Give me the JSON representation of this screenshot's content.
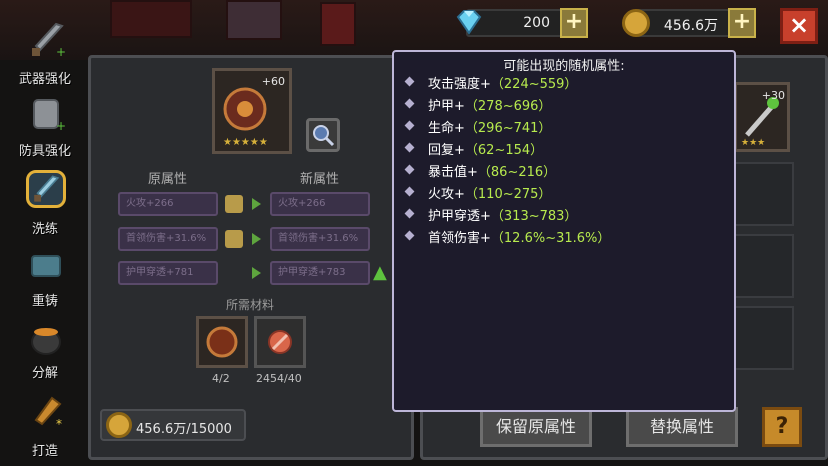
{
  "currency": {
    "gems": "200",
    "coins": "456.6万"
  },
  "sidebar": {
    "items": [
      {
        "label": "武器强化"
      },
      {
        "label": "防具强化"
      },
      {
        "label": "洗练"
      },
      {
        "label": "重铸"
      },
      {
        "label": "分解"
      },
      {
        "label": "打造"
      }
    ]
  },
  "item": {
    "level_badge": "+60",
    "compare_level_badge": "+30"
  },
  "attributes": {
    "old_header": "原属性",
    "new_header": "新属性",
    "rows": [
      {
        "old": "火攻+266",
        "new": "火攻+266"
      },
      {
        "old": "首领伤害+31.6%",
        "new": "首领伤害+31.6%"
      },
      {
        "old": "护甲穿透+781",
        "new": "护甲穿透+783"
      }
    ]
  },
  "materials": {
    "header": "所需材料",
    "items": [
      {
        "count": "4/2"
      },
      {
        "count": "2454/40"
      }
    ]
  },
  "cost": "456.6万/15000",
  "buttons": {
    "keep": "保留原属性",
    "replace": "替换属性",
    "help": "?",
    "close": "×"
  },
  "tooltip": {
    "title": "可能出现的随机属性:",
    "rows": [
      {
        "name": "攻击强度+",
        "range": "（224~559）"
      },
      {
        "name": "护甲+",
        "range": "（278~696）"
      },
      {
        "name": "生命+",
        "range": "（296~741）"
      },
      {
        "name": "回复+",
        "range": "（62~154）"
      },
      {
        "name": "暴击值+",
        "range": "（86~216）"
      },
      {
        "name": "火攻+",
        "range": "（110~275）"
      },
      {
        "name": "护甲穿透+",
        "range": "（313~783）"
      },
      {
        "name": "首领伤害+",
        "range": "（12.6%~31.6%）"
      }
    ]
  },
  "colors": {
    "accent_gold": "#e3b13a",
    "range_green": "#b7ea4e",
    "close_red": "#c8402c"
  }
}
